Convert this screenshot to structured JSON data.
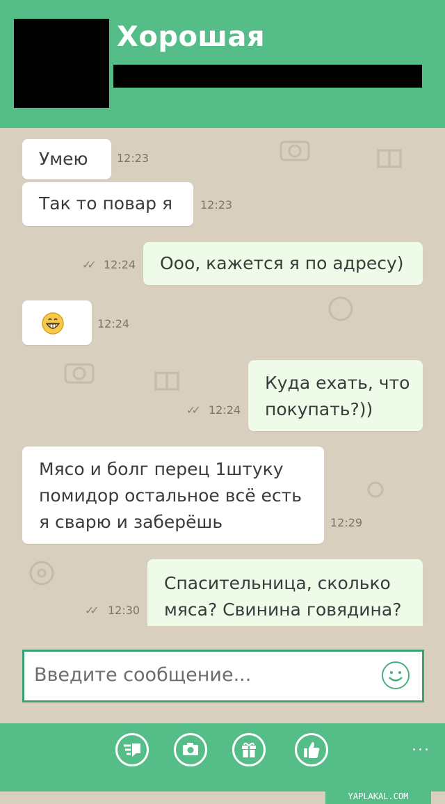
{
  "header": {
    "title": "Хорошая"
  },
  "messages": [
    {
      "dir": "in",
      "lines": [
        "Умею"
      ],
      "time": "12:23"
    },
    {
      "dir": "in",
      "lines": [
        "Так то повар я"
      ],
      "time": "12:23"
    },
    {
      "dir": "out",
      "lines": [
        "Ооо, кажется я по адресу)"
      ],
      "time": "12:24",
      "read": true
    },
    {
      "dir": "in",
      "emoji": "grinning-face-icon",
      "time": "12:24"
    },
    {
      "dir": "out",
      "lines": [
        "Куда ехать, что",
        "покупать?))"
      ],
      "time": "12:24",
      "read": true
    },
    {
      "dir": "in",
      "lines": [
        "Мясо и болг перец 1штуку",
        "помидор остальное всё есть",
        "я сварю и заберёшь"
      ],
      "time": "12:29"
    },
    {
      "dir": "out",
      "lines": [
        "Спасительница, сколько",
        "мяса? Свинина говядина?"
      ],
      "time": "12:30",
      "read": true
    }
  ],
  "composer": {
    "placeholder": "Введите сообщение..."
  },
  "toolbar": {
    "buttons": [
      "send-icon",
      "camera-icon",
      "gift-icon",
      "thumbs-up-icon"
    ],
    "more": "..."
  },
  "watermark": "YAPLAKAL.COM",
  "colors": {
    "accent": "#54bd88",
    "incoming": "#ffffff",
    "outgoing": "#eefbe9",
    "background": "#d9cfbf"
  }
}
